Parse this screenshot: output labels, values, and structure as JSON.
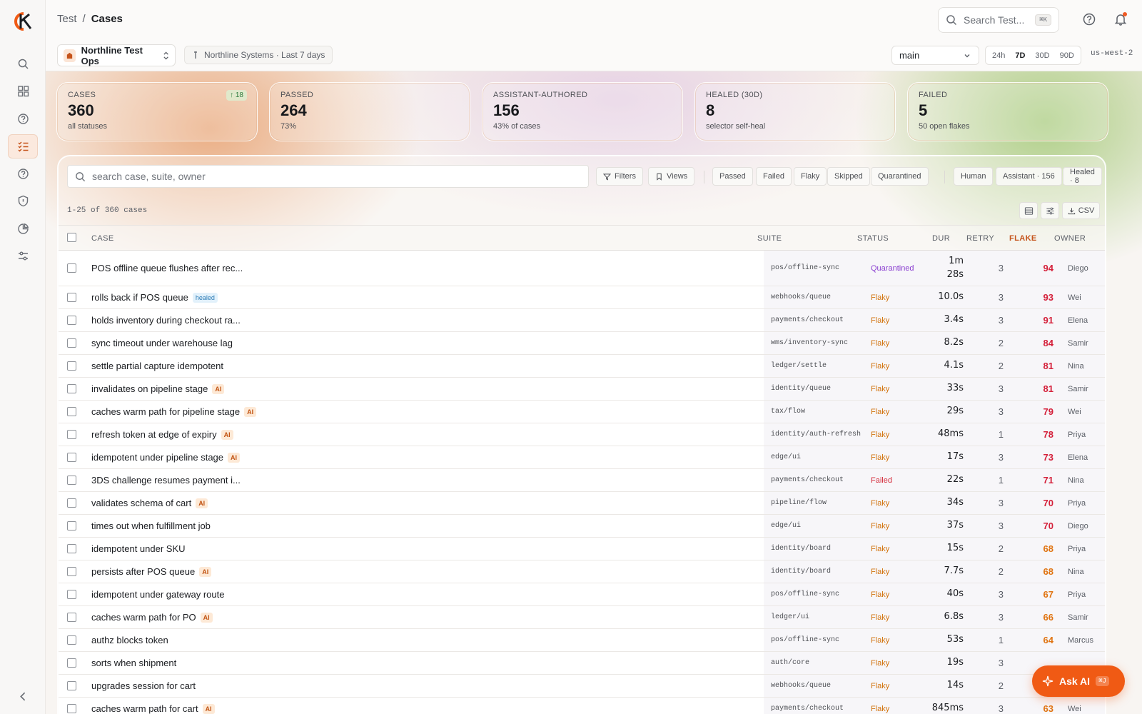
{
  "app": {
    "breadcrumb": [
      "Test",
      "Cases"
    ],
    "search_placeholder": "Search Test...",
    "search_shortcut": "⌘K",
    "accent": "#f05a14"
  },
  "rail": {
    "items": [
      {
        "icon": "search-icon"
      },
      {
        "icon": "dashboard-icon"
      },
      {
        "icon": "help-circle-icon"
      },
      {
        "icon": "test-cases-icon",
        "active": true
      },
      {
        "icon": "help-circle-icon"
      },
      {
        "icon": "shield-icon"
      },
      {
        "icon": "pie-chart-icon"
      },
      {
        "icon": "sliders-icon"
      }
    ],
    "collapse_icon": "chevron-left-icon"
  },
  "subbar": {
    "project": "Northline Test Ops",
    "context": "Northline Systems · Last 7 days",
    "branch": "main",
    "ranges": [
      "24h",
      "7D",
      "30D",
      "90D"
    ],
    "active_range": "7D",
    "region": "us-west-2"
  },
  "cards": [
    {
      "label": "CASES",
      "value": "360",
      "sub": "all statuses",
      "delta": "↑ 18"
    },
    {
      "label": "PASSED",
      "value": "264",
      "sub": "73%"
    },
    {
      "label": "ASSISTANT-AUTHORED",
      "value": "156",
      "sub": "43% of cases"
    },
    {
      "label": "HEALED (30D)",
      "value": "8",
      "sub": "selector self-heal"
    },
    {
      "label": "FAILED",
      "value": "5",
      "sub": "50 open flakes"
    }
  ],
  "toolbar": {
    "search_placeholder": "search case, suite, owner",
    "filters_label": "Filters",
    "views_label": "Views",
    "status_chips": [
      "Passed",
      "Failed",
      "Flaky",
      "Skipped",
      "Quarantined"
    ],
    "author_chips": [
      "Human",
      "Assistant · 156",
      "Healed · 8"
    ],
    "count_text": "1-25 of 360 cases",
    "csv_label": "CSV"
  },
  "table": {
    "headers": {
      "case": "CASE",
      "suite": "SUITE",
      "status": "STATUS",
      "dur": "DUR",
      "retry": "RETRY",
      "flake": "FLAKE",
      "owner": "OWNER"
    },
    "rows": [
      {
        "name": "POS offline queue flushes after rec...",
        "tag": "",
        "suite": "pos/offline-sync",
        "status": "Quarantined",
        "dur": "1m\n28s",
        "retry": "3",
        "flake": "94",
        "owner": "Diego"
      },
      {
        "name": "rolls back if POS queue",
        "tag": "healed",
        "suite": "webhooks/queue",
        "status": "Flaky",
        "dur": "10.0s",
        "retry": "3",
        "flake": "93",
        "owner": "Wei"
      },
      {
        "name": "holds inventory during checkout ra...",
        "tag": "",
        "suite": "payments/checkout",
        "status": "Flaky",
        "dur": "3.4s",
        "retry": "3",
        "flake": "91",
        "owner": "Elena"
      },
      {
        "name": "sync timeout under warehouse lag",
        "tag": "",
        "suite": "wms/inventory-sync",
        "status": "Flaky",
        "dur": "8.2s",
        "retry": "2",
        "flake": "84",
        "owner": "Samir"
      },
      {
        "name": "settle partial capture idempotent",
        "tag": "",
        "suite": "ledger/settle",
        "status": "Flaky",
        "dur": "4.1s",
        "retry": "2",
        "flake": "81",
        "owner": "Nina"
      },
      {
        "name": "invalidates on pipeline stage",
        "tag": "AI",
        "suite": "identity/queue",
        "status": "Flaky",
        "dur": "33s",
        "retry": "3",
        "flake": "81",
        "owner": "Samir"
      },
      {
        "name": "caches warm path for pipeline stage",
        "tag": "AI",
        "suite": "tax/flow",
        "status": "Flaky",
        "dur": "29s",
        "retry": "3",
        "flake": "79",
        "owner": "Wei"
      },
      {
        "name": "refresh token at edge of expiry",
        "tag": "AI",
        "suite": "identity/auth-refresh",
        "status": "Flaky",
        "dur": "48ms",
        "retry": "1",
        "flake": "78",
        "owner": "Priya"
      },
      {
        "name": "idempotent under pipeline stage",
        "tag": "AI",
        "suite": "edge/ui",
        "status": "Flaky",
        "dur": "17s",
        "retry": "3",
        "flake": "73",
        "owner": "Elena"
      },
      {
        "name": "3DS challenge resumes payment i...",
        "tag": "",
        "suite": "payments/checkout",
        "status": "Failed",
        "dur": "22s",
        "retry": "1",
        "flake": "71",
        "owner": "Nina"
      },
      {
        "name": "validates schema of cart",
        "tag": "AI",
        "suite": "pipeline/flow",
        "status": "Flaky",
        "dur": "34s",
        "retry": "3",
        "flake": "70",
        "owner": "Priya"
      },
      {
        "name": "times out when fulfillment job",
        "tag": "",
        "suite": "edge/ui",
        "status": "Flaky",
        "dur": "37s",
        "retry": "3",
        "flake": "70",
        "owner": "Diego"
      },
      {
        "name": "idempotent under SKU",
        "tag": "",
        "suite": "identity/board",
        "status": "Flaky",
        "dur": "15s",
        "retry": "2",
        "flake": "68",
        "owner": "Priya"
      },
      {
        "name": "persists after POS queue",
        "tag": "AI",
        "suite": "identity/board",
        "status": "Flaky",
        "dur": "7.7s",
        "retry": "2",
        "flake": "68",
        "owner": "Nina"
      },
      {
        "name": "idempotent under gateway route",
        "tag": "",
        "suite": "pos/offline-sync",
        "status": "Flaky",
        "dur": "40s",
        "retry": "3",
        "flake": "67",
        "owner": "Priya"
      },
      {
        "name": "caches warm path for PO",
        "tag": "AI",
        "suite": "ledger/ui",
        "status": "Flaky",
        "dur": "6.8s",
        "retry": "3",
        "flake": "66",
        "owner": "Samir"
      },
      {
        "name": "authz blocks token",
        "tag": "",
        "suite": "pos/offline-sync",
        "status": "Flaky",
        "dur": "53s",
        "retry": "1",
        "flake": "64",
        "owner": "Marcus"
      },
      {
        "name": "sorts when shipment",
        "tag": "",
        "suite": "auth/core",
        "status": "Flaky",
        "dur": "19s",
        "retry": "3",
        "flake": "",
        "owner": ""
      },
      {
        "name": "upgrades session for cart",
        "tag": "",
        "suite": "webhooks/queue",
        "status": "Flaky",
        "dur": "14s",
        "retry": "2",
        "flake": "",
        "owner": ""
      },
      {
        "name": "caches warm path for cart",
        "tag": "AI",
        "suite": "payments/checkout",
        "status": "Flaky",
        "dur": "845ms",
        "retry": "3",
        "flake": "63",
        "owner": "Wei"
      }
    ]
  },
  "ask_ai": {
    "label": "Ask AI",
    "shortcut": "⌘J"
  }
}
